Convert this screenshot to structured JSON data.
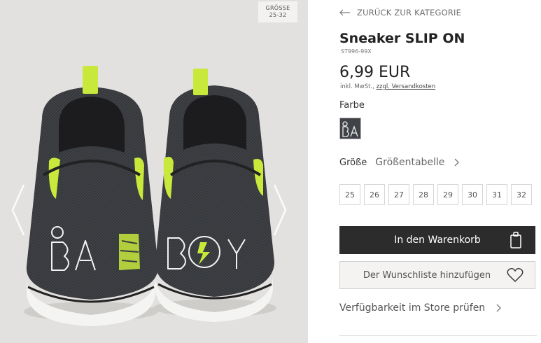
{
  "gallery": {
    "size_badge": {
      "label": "GRÖSSE",
      "value": "25-32"
    },
    "print_text": "BAD BOY"
  },
  "product": {
    "back_label": "ZURÜCK ZUR KATEGORIE",
    "title": "Sneaker SLIP ON",
    "sku": "ST996-99X",
    "price": "6,99 EUR",
    "tax_prefix": "inkl. MwSt.,",
    "shipping_link": "zzgl. Versandkosten",
    "color_label": "Farbe",
    "swatch_icon": "bad-boy-print-swatch",
    "size_label": "Größe",
    "size_chart_label": "Größentabelle",
    "sizes": [
      "25",
      "26",
      "27",
      "28",
      "29",
      "30",
      "31",
      "32"
    ],
    "cart_label": "In den Warenkorb",
    "wishlist_label": "Der Wunschliste hinzufügen",
    "store_label": "Verfügbarkeit im Store prüfen"
  },
  "icons": {
    "back": "arrow-left-icon",
    "prev": "chevron-left-icon",
    "next": "chevron-right-icon",
    "cart": "shopping-bag-icon",
    "wishlist": "heart-icon"
  },
  "colors": {
    "accent_dark": "#2c2c2c",
    "neon": "#c8e83c",
    "shoe_body": "#3a3c40",
    "background": "#e3e1df"
  }
}
